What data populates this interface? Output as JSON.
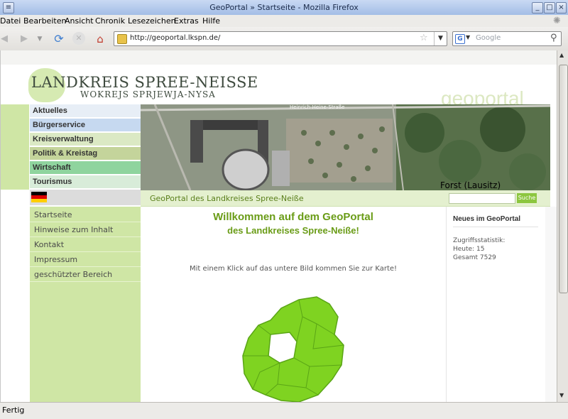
{
  "window": {
    "title": "GeoPortal » Startseite - Mozilla Firefox",
    "status": "Fertig"
  },
  "menu": [
    "Datei",
    "Bearbeiten",
    "Ansicht",
    "Chronik",
    "Lesezeichen",
    "Extras",
    "Hilfe"
  ],
  "toolbar": {
    "url": "http://geoportal.lkspn.de/",
    "search_placeholder": "Google",
    "icons": [
      "back-icon",
      "forward-icon",
      "reload-icon",
      "stop-icon",
      "home-icon"
    ]
  },
  "header": {
    "brand_line1": "LANDKREIS SPREE-NEISSE",
    "brand_line2": "WOKREJS SPRJEWJA-NYSA",
    "watermark": "geoportal"
  },
  "nav": {
    "items": [
      {
        "label": "Aktuelles",
        "color": "#e7eef6"
      },
      {
        "label": "Bürgerservice",
        "color": "#c6d9f0"
      },
      {
        "label": "Kreisverwaltung",
        "color": "#dbe9c4"
      },
      {
        "label": "Politik & Kreistag",
        "color": "#c4d49b"
      },
      {
        "label": "Wirtschaft",
        "color": "#8fd49e"
      },
      {
        "label": "Tourismus",
        "color": "#d8ecd9"
      }
    ]
  },
  "aerial": {
    "street_label": "Heinrich-Heine-Straße",
    "city_label": "Forst (Lausitz)"
  },
  "subnav": {
    "title": "GeoPortal des Landkreises Spree-Neiße",
    "search_button": "Suche"
  },
  "sidebar": {
    "items": [
      "Startseite",
      "Hinweise zum Inhalt",
      "Kontakt",
      "Impressum",
      "geschützter Bereich"
    ]
  },
  "main": {
    "heading_line1": "Willkommen auf dem GeoPortal",
    "heading_line2": "des Landkreises Spree-Neiße!",
    "intro": "Mit einem Klick auf das untere Bild kommen Sie zur Karte!"
  },
  "news": {
    "title": "Neues im GeoPortal",
    "stats_label": "Zugriffsstatistik:",
    "today": "Heute: 15",
    "total": "Gesamt 7529"
  },
  "colors": {
    "accent_green": "#6a9c17",
    "left_green": "#cfe6a5",
    "map_green": "#7fd321"
  }
}
